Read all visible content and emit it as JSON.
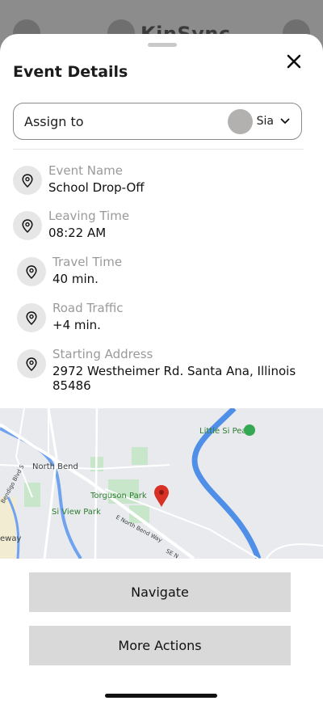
{
  "background_app": {
    "title": "KinSync"
  },
  "sheet": {
    "title": "Event Details",
    "close_icon": "close-icon"
  },
  "assign": {
    "label": "Assign to",
    "selected": "Sia"
  },
  "details": [
    {
      "label": "Event Name",
      "value": "School Drop-Off",
      "icon": "location-pin-icon"
    },
    {
      "label": "Leaving Time",
      "value": "08:22 AM",
      "icon": "location-pin-icon"
    },
    {
      "label": "Travel Time",
      "value": "40 min.",
      "icon": "location-pin-icon"
    },
    {
      "label": "Road Traffic",
      "value": "+4 min.",
      "icon": "location-pin-icon"
    },
    {
      "label": "Starting Address",
      "value": "2972 Westheimer Rd. Santa Ana, Illinois 85486",
      "icon": "location-pin-icon"
    }
  ],
  "map": {
    "labels": {
      "north_bend": "North Bend",
      "torguson_park": "Torguson Park",
      "si_view_park": "Si View Park",
      "little_si_peak": "Little Si Peak",
      "north_bend_way": "E North Bend Way",
      "bendigo": "Bendigo Blvd S",
      "safeway": "eway",
      "se_n": "SE N"
    },
    "marker_color": "#d93025"
  },
  "actions": {
    "navigate": "Navigate",
    "more": "More Actions"
  }
}
